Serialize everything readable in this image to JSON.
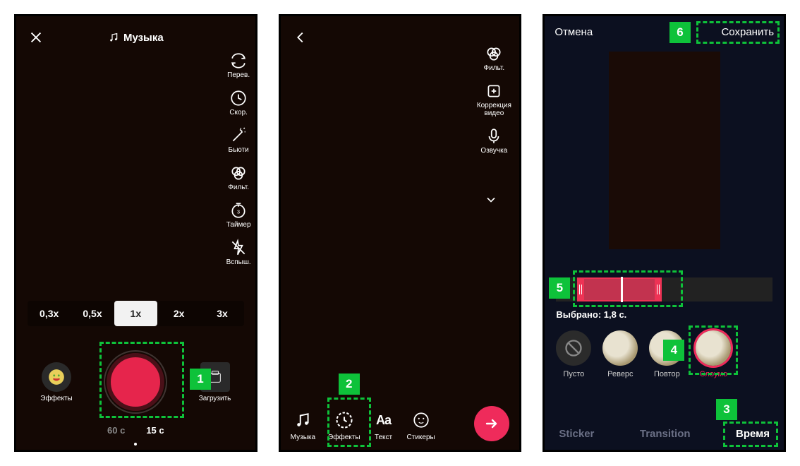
{
  "screen1": {
    "music_label": "Музыка",
    "side_tools": [
      {
        "id": "flip",
        "label": "Перев."
      },
      {
        "id": "speed",
        "label": "Скор."
      },
      {
        "id": "beauty",
        "label": "Бьюти"
      },
      {
        "id": "filters",
        "label": "Фильт."
      },
      {
        "id": "timer",
        "label": "Таймер"
      },
      {
        "id": "flash",
        "label": "Вспыш."
      }
    ],
    "speeds": [
      "0,3x",
      "0,5x",
      "1x",
      "2x",
      "3x"
    ],
    "speed_selected_index": 2,
    "effects_label": "Эффекты",
    "upload_label": "Загрузить",
    "durations": [
      "60 с",
      "15 с"
    ],
    "duration_selected_index": 1
  },
  "screen2": {
    "side_tools": [
      {
        "id": "filters",
        "label": "Фильт."
      },
      {
        "id": "adjust",
        "label": "Коррекция видео"
      },
      {
        "id": "voiceover",
        "label": "Озвучка"
      }
    ],
    "edit_tools": [
      {
        "id": "music",
        "label": "Музыка"
      },
      {
        "id": "effects",
        "label": "Эффекты"
      },
      {
        "id": "text",
        "label": "Текст"
      },
      {
        "id": "stickers",
        "label": "Стикеры"
      }
    ]
  },
  "screen3": {
    "cancel": "Отмена",
    "save": "Сохранить",
    "selected_label": "Выбрано: 1,8 с.",
    "effects": [
      {
        "id": "none",
        "label": "Пусто"
      },
      {
        "id": "reverse",
        "label": "Реверс"
      },
      {
        "id": "repeat",
        "label": "Повтор"
      },
      {
        "id": "slomo",
        "label": "Слоумо"
      }
    ],
    "effects_selected_index": 3,
    "bottom_tabs": [
      "Sticker",
      "Transition",
      "Время"
    ],
    "bottom_tabs_selected_index": 2
  },
  "annotations": {
    "1": "1",
    "2": "2",
    "3": "3",
    "4": "4",
    "5": "5",
    "6": "6"
  }
}
